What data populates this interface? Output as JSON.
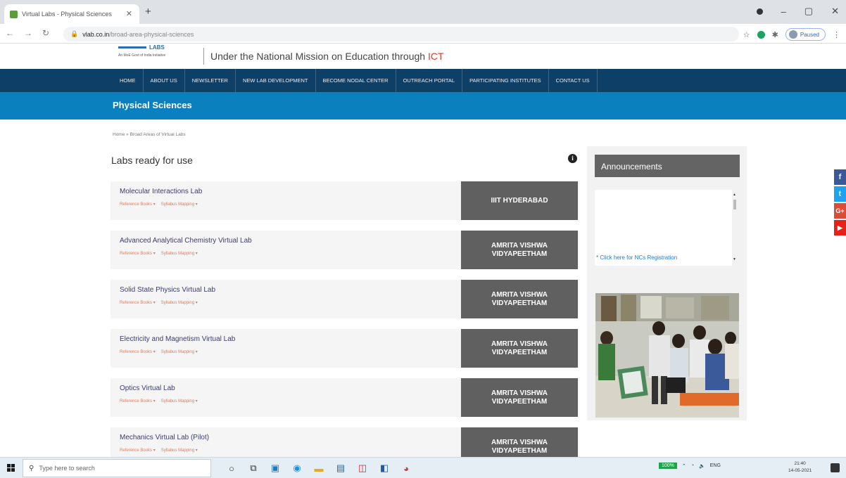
{
  "browser": {
    "tab_title": "Virtual Labs - Physical Sciences",
    "new_tab": "+",
    "url_host": "vlab.co.in",
    "url_path": "/broad-area-physical-sciences",
    "profile_label": "Paused",
    "window_controls": [
      "–",
      "▢",
      "✕"
    ]
  },
  "header": {
    "tagline_prefix": "Under the National Mission on Education through",
    "tagline_ict": "ICT",
    "logo_caption": "An MoE Govt of India Initiative"
  },
  "nav": {
    "items": [
      "HOME",
      "ABOUT US",
      "NEWSLETTER",
      "NEW LAB DEVELOPMENT",
      "BECOME NODAL CENTER",
      "OUTREACH PORTAL",
      "PARTICIPATING INSTITUTES",
      "CONTACT US"
    ]
  },
  "page": {
    "title": "Physical Sciences",
    "breadcrumb": "Home » Broad Areas of Virtual Labs",
    "labs_heading": "Labs ready for use"
  },
  "labs": [
    {
      "name": "Molecular Interactions Lab",
      "ref": "Reference Books ▾",
      "syllabus": "Syllabus Mapping ▾",
      "institute": "IIIT HYDERABAD"
    },
    {
      "name": "Advanced Analytical Chemistry Virtual Lab",
      "ref": "Reference Books ▾",
      "syllabus": "Syllabus Mapping ▾",
      "institute": "AMRITA VISHWA VIDYAPEETHAM"
    },
    {
      "name": "Solid State Physics Virtual Lab",
      "ref": "Reference Books ▾",
      "syllabus": "Syllabus Mapping ▾",
      "institute": "AMRITA VISHWA VIDYAPEETHAM"
    },
    {
      "name": "Electricity and Magnetism Virtual Lab",
      "ref": "Reference Books ▾",
      "syllabus": "Syllabus Mapping ▾",
      "institute": "AMRITA VISHWA VIDYAPEETHAM"
    },
    {
      "name": "Optics Virtual Lab",
      "ref": "Reference Books ▾",
      "syllabus": "Syllabus Mapping ▾",
      "institute": "AMRITA VISHWA VIDYAPEETHAM"
    },
    {
      "name": "Mechanics Virtual Lab (Pilot)",
      "ref": "Reference Books ▾",
      "syllabus": "Syllabus Mapping ▾",
      "institute": "AMRITA VISHWA VIDYAPEETHAM"
    }
  ],
  "sidebar": {
    "announcements_title": "Announcements",
    "announcement_link": "* Click here for NCs Registration"
  },
  "social": [
    {
      "icon": "facebook-icon",
      "glyph": "f",
      "color": "#3b5998"
    },
    {
      "icon": "twitter-icon",
      "glyph": "t",
      "color": "#1da1f2"
    },
    {
      "icon": "google-plus-icon",
      "glyph": "G+",
      "color": "#dd4b39"
    },
    {
      "icon": "youtube-icon",
      "glyph": "▶",
      "color": "#e62117"
    }
  ],
  "taskbar": {
    "search_placeholder": "Type here to search",
    "battery": "100%",
    "lang": "ENG",
    "time": "21:40",
    "date": "14-05-2021"
  }
}
